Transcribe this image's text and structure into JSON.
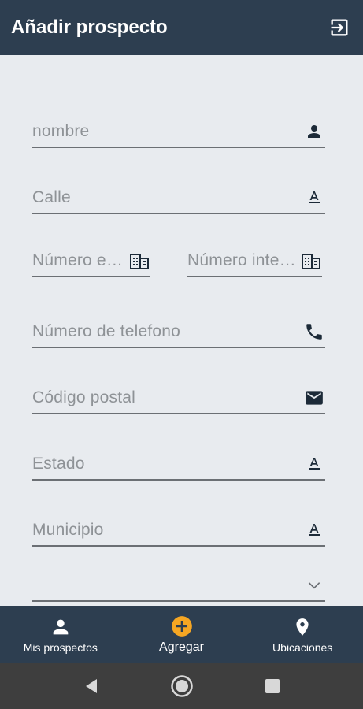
{
  "appbar": {
    "title": "Añadir prospecto",
    "logout_icon": "logout-icon"
  },
  "form": {
    "fields": [
      {
        "placeholder": "nombre",
        "icon": "person-icon"
      },
      {
        "placeholder": "Calle",
        "icon": "text-format-icon"
      },
      {
        "placeholder": "Número exterior",
        "icon": "building-icon"
      },
      {
        "placeholder": "Número interior",
        "icon": "building-icon"
      },
      {
        "placeholder": "Número de telefono",
        "icon": "phone-icon"
      },
      {
        "placeholder": "Código postal",
        "icon": "mail-icon"
      },
      {
        "placeholder": "Estado",
        "icon": "text-format-icon"
      },
      {
        "placeholder": "Municipio",
        "icon": "text-format-icon"
      },
      {
        "placeholder": "",
        "icon": "chevron-down-icon"
      }
    ]
  },
  "bottomnav": {
    "items": [
      {
        "label": "Mis prospectos",
        "icon": "person-icon"
      },
      {
        "label": "Agregar",
        "icon": "add-circle-icon",
        "accent": "#f5a623"
      },
      {
        "label": "Ubicaciones",
        "icon": "location-pin-icon"
      }
    ]
  },
  "colors": {
    "appbar": "#2d3e50",
    "background": "#e8ebef",
    "accent": "#f5a623"
  }
}
